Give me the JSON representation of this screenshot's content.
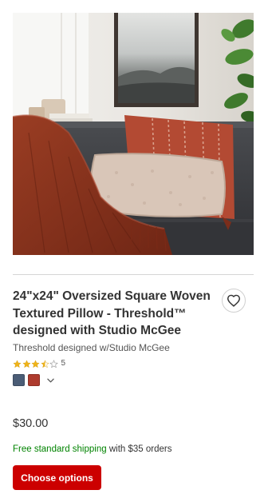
{
  "product": {
    "title": "24\"x24\" Oversized Square Woven Textured Pillow - Threshold™ designed with Studio McGee",
    "brand": "Threshold designed w/Studio McGee",
    "rating": {
      "stars": 3.5,
      "max_stars": 5,
      "review_count": "5"
    },
    "swatches": [
      {
        "name": "blue-gray",
        "color": "#4b5d76"
      },
      {
        "name": "rust-red",
        "color": "#ae3b2e"
      }
    ],
    "price": "$30.00",
    "shipping": {
      "free_label": "Free standard shipping",
      "condition": " with $35 orders"
    },
    "cta_label": "Choose options"
  },
  "icons": {
    "favorite": "heart-outline-icon",
    "expand_swatches": "chevron-down-icon"
  },
  "colors": {
    "cta": "#cc0000",
    "shipping_free": "#008300",
    "star": "#f0b419"
  }
}
